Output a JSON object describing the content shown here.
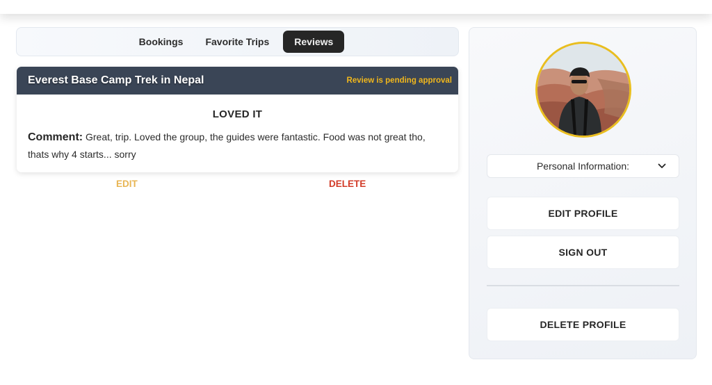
{
  "tabs": [
    {
      "label": "Bookings",
      "active": false
    },
    {
      "label": "Favorite Trips",
      "active": false
    },
    {
      "label": "Reviews",
      "active": true
    }
  ],
  "review": {
    "title": "Everest Base Camp Trek in Nepal",
    "status": "Review is pending approval",
    "rating_text": "LOVED IT",
    "comment_label": "Comment:",
    "comment_text": " Great, trip. Loved the group, the guides were fantastic. Food was not great tho, thats why 4 starts... sorry",
    "edit_label": "EDIT",
    "delete_label": "DELETE"
  },
  "profile": {
    "dropdown_label": "Personal Information:",
    "edit_profile_label": "EDIT PROFILE",
    "sign_out_label": "SIGN OUT",
    "delete_profile_label": "DELETE PROFILE"
  },
  "colors": {
    "header_bg": "#3a4556",
    "pending": "#f1b71c",
    "edit": "#e8b553",
    "delete": "#d23b28",
    "avatar_ring": "#e9be1f",
    "active_tab": "#262626"
  },
  "icons": {
    "dropdown": "chevron-down-icon"
  }
}
